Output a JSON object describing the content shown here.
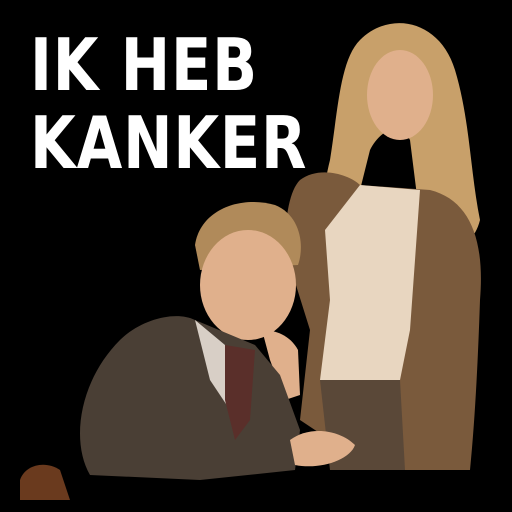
{
  "sticker": {
    "caption_lines": [
      "IK HEB",
      "KANKER"
    ],
    "colors": {
      "background": "#000000",
      "caption_text": "#ffffff",
      "woman_hair": "#c8a06a",
      "woman_cardigan": "#7a5a3c",
      "woman_blouse": "#e8d6c0",
      "man_jacket": "#4a3f35",
      "man_hair": "#b08a5a",
      "skin": "#e0b08c"
    }
  }
}
